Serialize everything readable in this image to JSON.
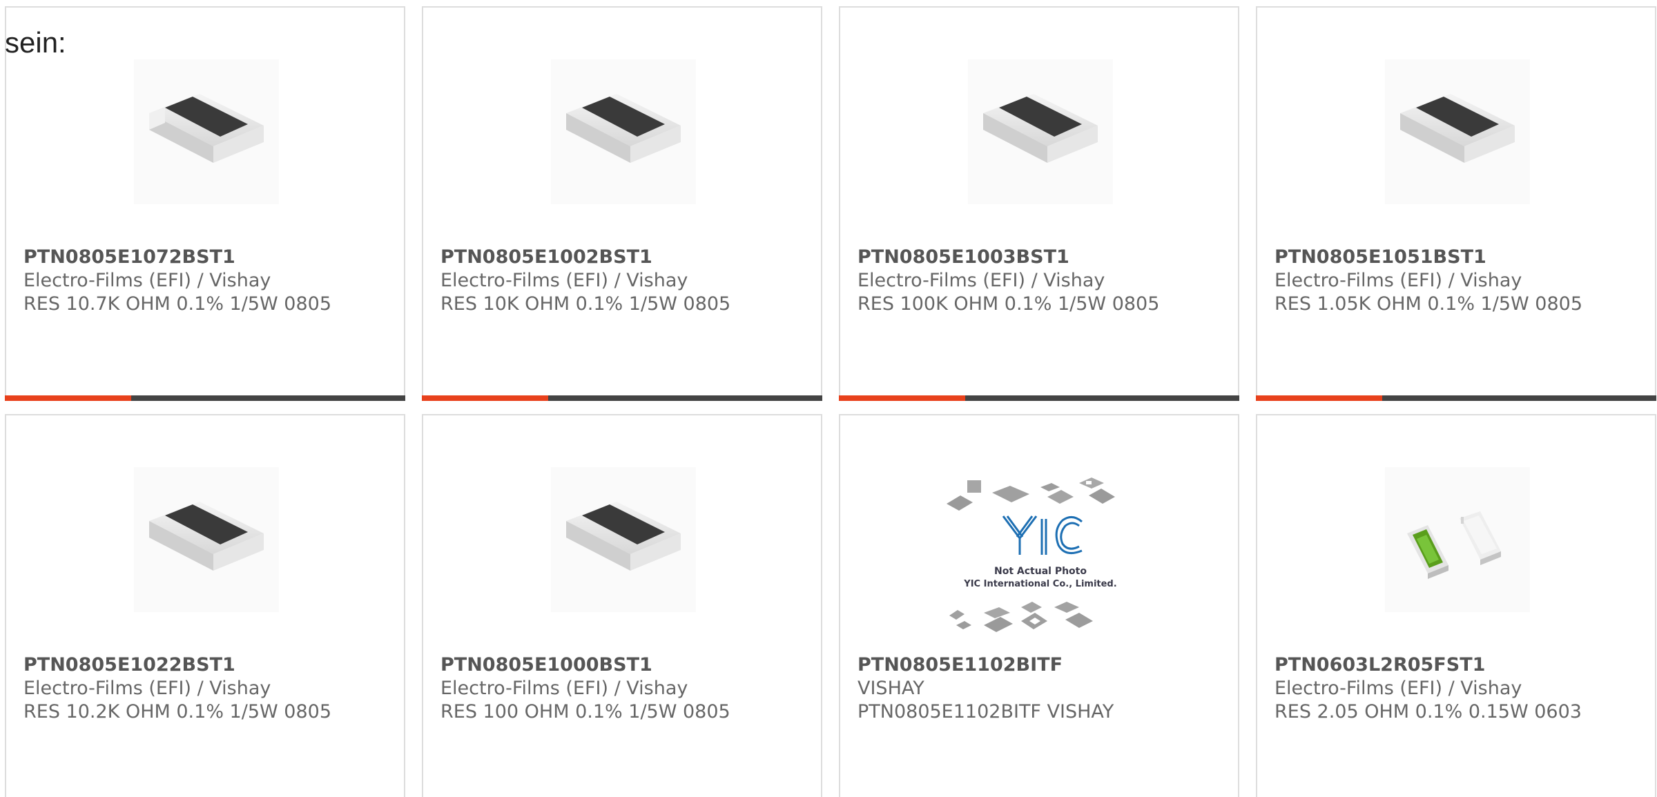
{
  "intro_text": "sein:",
  "products": [
    {
      "part_number": "PTN0805E1072BST1",
      "manufacturer": "Electro-Films (EFI) / Vishay",
      "description": "RES 10.7K OHM 0.1% 1/5W 0805",
      "image": "chip-resistor-0805-icon"
    },
    {
      "part_number": "PTN0805E1002BST1",
      "manufacturer": "Electro-Films (EFI) / Vishay",
      "description": "RES 10K OHM 0.1% 1/5W 0805",
      "image": "chip-resistor-0805-icon"
    },
    {
      "part_number": "PTN0805E1003BST1",
      "manufacturer": "Electro-Films (EFI) / Vishay",
      "description": "RES 100K OHM 0.1% 1/5W 0805",
      "image": "chip-resistor-0805-icon"
    },
    {
      "part_number": "PTN0805E1051BST1",
      "manufacturer": "Electro-Films (EFI) / Vishay",
      "description": "RES 1.05K OHM 0.1% 1/5W 0805",
      "image": "chip-resistor-0805-icon"
    },
    {
      "part_number": "PTN0805E1022BST1",
      "manufacturer": "Electro-Films (EFI) / Vishay",
      "description": "RES 10.2K OHM 0.1% 1/5W 0805",
      "image": "chip-resistor-0805-icon"
    },
    {
      "part_number": "PTN0805E1000BST1",
      "manufacturer": "Electro-Films (EFI) / Vishay",
      "description": "RES 100 OHM 0.1% 1/5W 0805",
      "image": "chip-resistor-0805-icon"
    },
    {
      "part_number": "PTN0805E1102BITF",
      "manufacturer": "VISHAY",
      "description": "PTN0805E1102BITF VISHAY",
      "image": "not-actual-photo-placeholder",
      "placeholder_lines": [
        "Not Actual Photo",
        "YIC International Co., Limited."
      ],
      "placeholder_logo": "YIC"
    },
    {
      "part_number": "PTN0603L2R05FST1",
      "manufacturer": "Electro-Films (EFI) / Vishay",
      "description": "RES 2.05 OHM 0.1% 0.15W 0603",
      "image": "chip-resistor-0603-pair-icon"
    }
  ],
  "colors": {
    "accent": "#e8411c",
    "bar_dark": "#444444",
    "card_border": "#dddddd",
    "text": "#666666",
    "part_number": "#555555"
  }
}
